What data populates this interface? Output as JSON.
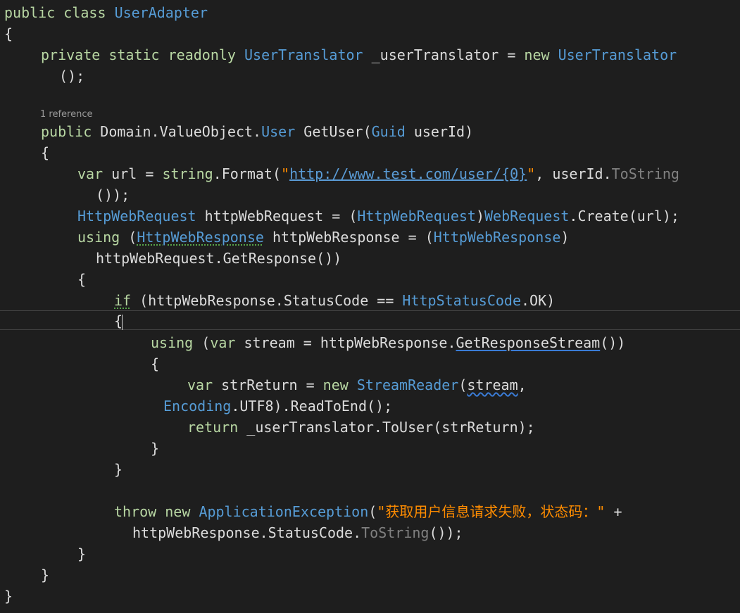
{
  "codelens": {
    "references": "1 reference"
  },
  "colors": {
    "background": "#1e1e1e",
    "keyword": "#569cd6",
    "type": "#4ec9b0",
    "string": "#d69d85",
    "plain": "#dcdcdc",
    "chinese_string": "#ff8c00"
  },
  "code": {
    "l1": {
      "kw_public": "public",
      "kw_class": "class",
      "type_name": "UserAdapter"
    },
    "l2": {
      "brace": "{"
    },
    "l3": {
      "kw_private": "private",
      "kw_static": "static",
      "kw_readonly": "readonly",
      "type_translator": "UserTranslator",
      "field": "_userTranslator",
      "equals": "=",
      "kw_new": "new",
      "type_translator_2": "UserTranslator"
    },
    "l4": {
      "text": "();"
    },
    "l5": {
      "kw_public": "public",
      "ns": "Domain.ValueObject.",
      "type_user": "User",
      "method": "GetUser(",
      "type_guid": "Guid",
      "param": "userId)"
    },
    "l6": {
      "brace": "{"
    },
    "l7": {
      "kw_var": "var",
      "name": "url =",
      "kw_string": "string",
      "call": ".Format(",
      "quote_open": "\"",
      "url": "http://www.test.com/user/{0}",
      "quote_close": "\"",
      "rest": ", userId.",
      "method": "ToString"
    },
    "l8": {
      "text": "());"
    },
    "l9": {
      "type_req": "HttpWebRequest",
      "name": "httpWebRequest = (",
      "type_req_2": "HttpWebRequest",
      "paren": ")",
      "type_webreq": "WebRequest",
      "rest": ".Create(url);"
    },
    "l10": {
      "kw_using": "using",
      "paren": "(",
      "type_resp": "HttpWebResponse",
      "name": "httpWebResponse = (",
      "type_resp_2": "HttpWebResponse",
      "paren_close": ")"
    },
    "l11": {
      "text": "httpWebRequest.GetResponse())"
    },
    "l12": {
      "brace": "{"
    },
    "l13": {
      "kw_if": "if",
      "cond": "(httpWebResponse.StatusCode ==",
      "type_status": "HttpStatusCode",
      "rest": ".OK)"
    },
    "l14": {
      "brace": "{"
    },
    "l15": {
      "kw_using": "using",
      "paren": "(",
      "kw_var": "var",
      "name": "stream = httpWebResponse.",
      "method": "GetResponseStream",
      "rest": "())"
    },
    "l16": {
      "brace": "{"
    },
    "l17": {
      "kw_var": "var",
      "name": "strReturn =",
      "kw_new": "new",
      "type_reader": "StreamReader",
      "paren": "(",
      "arg": "stream",
      "comma": ","
    },
    "l18": {
      "type_encoding": "Encoding",
      "rest": ".UTF8).ReadToEnd();"
    },
    "l19": {
      "kw_return": "return",
      "rest": "_userTranslator.ToUser(strReturn);"
    },
    "l20": {
      "brace": "}"
    },
    "l21": {
      "brace": "}"
    },
    "l22": {
      "kw_throw": "throw",
      "kw_new": "new",
      "type_ex": "ApplicationException",
      "paren": "(",
      "message": "\"获取用户信息请求失败，状态码：\"",
      "plus": "+"
    },
    "l23": {
      "name": "httpWebResponse.StatusCode.",
      "method": "ToString",
      "rest": "());"
    },
    "l24": {
      "brace": "}"
    },
    "l25": {
      "brace": "}"
    },
    "l26": {
      "brace": "}"
    }
  }
}
